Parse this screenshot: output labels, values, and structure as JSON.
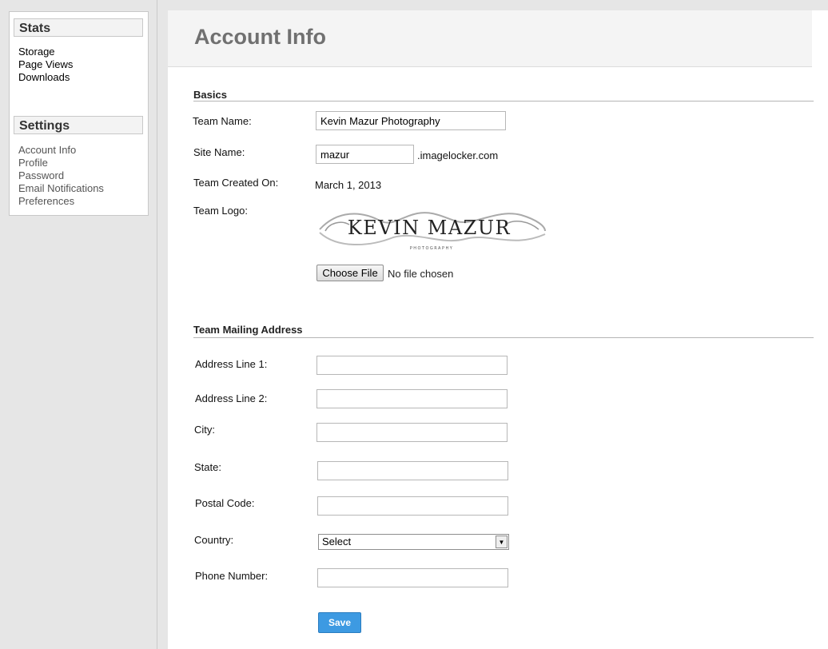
{
  "sidebar": {
    "stats_heading": "Stats",
    "stats_items": [
      "Storage",
      "Page Views",
      "Downloads"
    ],
    "settings_heading": "Settings",
    "settings_items": [
      "Account Info",
      "Profile",
      "Password",
      "Email Notifications",
      "Preferences"
    ]
  },
  "page": {
    "title": "Account Info"
  },
  "basics": {
    "heading": "Basics",
    "team_name_label": "Team Name:",
    "team_name_value": "Kevin Mazur Photography",
    "site_name_label": "Site Name:",
    "site_name_value": "mazur",
    "site_domain_suffix": ".imagelocker.com",
    "created_label": "Team Created On:",
    "created_value": "March 1, 2013",
    "logo_label": "Team Logo:",
    "logo_text": "KEVIN MAZUR",
    "logo_subtext": "PHOTOGRAPHY",
    "choose_file_label": "Choose File",
    "file_status": "No file chosen"
  },
  "address": {
    "heading": "Team Mailing Address",
    "line1_label": "Address Line 1:",
    "line1_value": "",
    "line2_label": "Address Line 2:",
    "line2_value": "",
    "city_label": "City:",
    "city_value": "",
    "state_label": "State:",
    "state_value": "",
    "postal_label": "Postal Code:",
    "postal_value": "",
    "country_label": "Country:",
    "country_selected": "Select",
    "phone_label": "Phone Number:",
    "phone_value": ""
  },
  "actions": {
    "save_label": "Save"
  },
  "colors": {
    "accent": "#3d9ae2",
    "title_gray": "#707070"
  }
}
